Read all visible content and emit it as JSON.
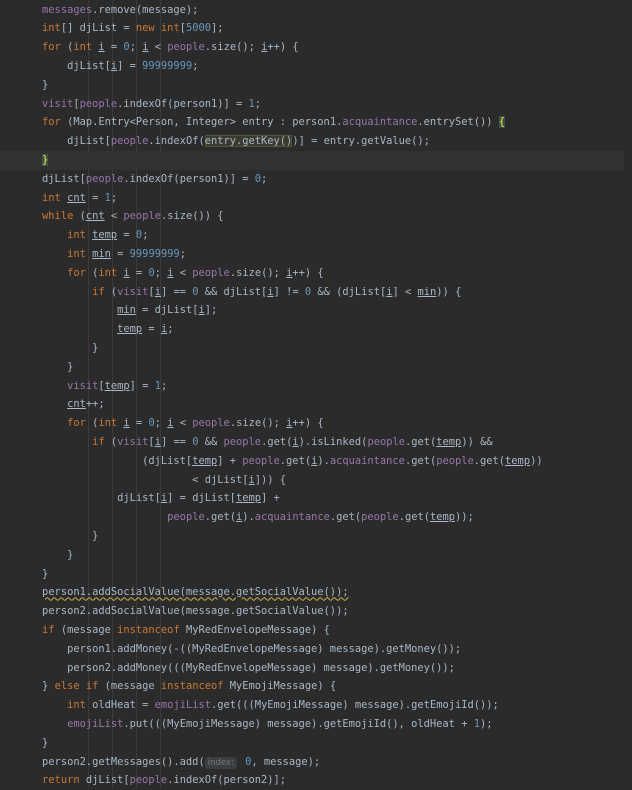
{
  "code_lines": [
    [
      [
        "t",
        "        "
      ],
      [
        "f",
        "messages"
      ],
      [
        "t",
        ".remove(message);"
      ]
    ],
    [
      [
        "t",
        "        "
      ],
      [
        "k",
        "int"
      ],
      [
        "t",
        "[] djList = "
      ],
      [
        "k",
        "new int"
      ],
      [
        "t",
        "["
      ],
      [
        "n",
        "5000"
      ],
      [
        "t",
        "];"
      ]
    ],
    [
      [
        "t",
        "        "
      ],
      [
        "k",
        "for "
      ],
      [
        "t",
        "("
      ],
      [
        "k",
        "int "
      ],
      [
        "u",
        "i"
      ],
      [
        "t",
        " = "
      ],
      [
        "n",
        "0"
      ],
      [
        "t",
        "; "
      ],
      [
        "u",
        "i"
      ],
      [
        "t",
        " < "
      ],
      [
        "f",
        "people"
      ],
      [
        "t",
        ".size(); "
      ],
      [
        "u",
        "i"
      ],
      [
        "t",
        "++) {"
      ]
    ],
    [
      [
        "t",
        "            djList["
      ],
      [
        "u",
        "i"
      ],
      [
        "t",
        "] = "
      ],
      [
        "n",
        "99999999"
      ],
      [
        "t",
        ";"
      ]
    ],
    [
      [
        "t",
        "        }"
      ]
    ],
    [
      [
        "t",
        "        "
      ],
      [
        "f",
        "visit"
      ],
      [
        "t",
        "["
      ],
      [
        "f",
        "people"
      ],
      [
        "t",
        ".indexOf(person1)] = "
      ],
      [
        "n",
        "1"
      ],
      [
        "t",
        ";"
      ]
    ],
    [
      [
        "t",
        "        "
      ],
      [
        "k",
        "for "
      ],
      [
        "t",
        "(Map.Entry<Person, Integer> entry : person1."
      ],
      [
        "f",
        "acquaintance"
      ],
      [
        "t",
        ".entrySet()) "
      ],
      [
        "b",
        "{"
      ]
    ],
    [
      [
        "t",
        "            djList["
      ],
      [
        "f",
        "people"
      ],
      [
        "t",
        ".indexOf("
      ],
      [
        "h",
        "entry.getKey()"
      ],
      [
        "t",
        ")] = entry.getValue();"
      ]
    ],
    [
      [
        "t",
        "        "
      ],
      [
        "b",
        "}"
      ]
    ],
    [
      [
        "t",
        "        djList["
      ],
      [
        "f",
        "people"
      ],
      [
        "t",
        ".indexOf(person1)] = "
      ],
      [
        "n",
        "0"
      ],
      [
        "t",
        ";"
      ]
    ],
    [
      [
        "t",
        "        "
      ],
      [
        "k",
        "int "
      ],
      [
        "u",
        "cnt"
      ],
      [
        "t",
        " = "
      ],
      [
        "n",
        "1"
      ],
      [
        "t",
        ";"
      ]
    ],
    [
      [
        "t",
        "        "
      ],
      [
        "k",
        "while "
      ],
      [
        "t",
        "("
      ],
      [
        "u",
        "cnt"
      ],
      [
        "t",
        " < "
      ],
      [
        "f",
        "people"
      ],
      [
        "t",
        ".size()) {"
      ]
    ],
    [
      [
        "t",
        "            "
      ],
      [
        "k",
        "int "
      ],
      [
        "u",
        "temp"
      ],
      [
        "t",
        " = "
      ],
      [
        "n",
        "0"
      ],
      [
        "t",
        ";"
      ]
    ],
    [
      [
        "t",
        "            "
      ],
      [
        "k",
        "int "
      ],
      [
        "u",
        "min"
      ],
      [
        "t",
        " = "
      ],
      [
        "n",
        "99999999"
      ],
      [
        "t",
        ";"
      ]
    ],
    [
      [
        "t",
        "            "
      ],
      [
        "k",
        "for "
      ],
      [
        "t",
        "("
      ],
      [
        "k",
        "int "
      ],
      [
        "u",
        "i"
      ],
      [
        "t",
        " = "
      ],
      [
        "n",
        "0"
      ],
      [
        "t",
        "; "
      ],
      [
        "u",
        "i"
      ],
      [
        "t",
        " < "
      ],
      [
        "f",
        "people"
      ],
      [
        "t",
        ".size(); "
      ],
      [
        "u",
        "i"
      ],
      [
        "t",
        "++) {"
      ]
    ],
    [
      [
        "t",
        "                "
      ],
      [
        "k",
        "if "
      ],
      [
        "t",
        "("
      ],
      [
        "f",
        "visit"
      ],
      [
        "t",
        "["
      ],
      [
        "u",
        "i"
      ],
      [
        "t",
        "] == "
      ],
      [
        "n",
        "0"
      ],
      [
        "t",
        " && djList["
      ],
      [
        "u",
        "i"
      ],
      [
        "t",
        "] != "
      ],
      [
        "n",
        "0"
      ],
      [
        "t",
        " && (djList["
      ],
      [
        "u",
        "i"
      ],
      [
        "t",
        "] < "
      ],
      [
        "u",
        "min"
      ],
      [
        "t",
        ")) {"
      ]
    ],
    [
      [
        "t",
        "                    "
      ],
      [
        "u",
        "min"
      ],
      [
        "t",
        " = djList["
      ],
      [
        "u",
        "i"
      ],
      [
        "t",
        "];"
      ]
    ],
    [
      [
        "t",
        "                    "
      ],
      [
        "u",
        "temp"
      ],
      [
        "t",
        " = "
      ],
      [
        "u",
        "i"
      ],
      [
        "t",
        ";"
      ]
    ],
    [
      [
        "t",
        "                }"
      ]
    ],
    [
      [
        "t",
        "            }"
      ]
    ],
    [
      [
        "t",
        "            "
      ],
      [
        "f",
        "visit"
      ],
      [
        "t",
        "["
      ],
      [
        "u",
        "temp"
      ],
      [
        "t",
        "] = "
      ],
      [
        "n",
        "1"
      ],
      [
        "t",
        ";"
      ]
    ],
    [
      [
        "t",
        "            "
      ],
      [
        "u",
        "cnt"
      ],
      [
        "t",
        "++;"
      ]
    ],
    [
      [
        "t",
        "            "
      ],
      [
        "k",
        "for "
      ],
      [
        "t",
        "("
      ],
      [
        "k",
        "int "
      ],
      [
        "u",
        "i"
      ],
      [
        "t",
        " = "
      ],
      [
        "n",
        "0"
      ],
      [
        "t",
        "; "
      ],
      [
        "u",
        "i"
      ],
      [
        "t",
        " < "
      ],
      [
        "f",
        "people"
      ],
      [
        "t",
        ".size(); "
      ],
      [
        "u",
        "i"
      ],
      [
        "t",
        "++) {"
      ]
    ],
    [
      [
        "t",
        "                "
      ],
      [
        "k",
        "if "
      ],
      [
        "t",
        "("
      ],
      [
        "f",
        "visit"
      ],
      [
        "t",
        "["
      ],
      [
        "u",
        "i"
      ],
      [
        "t",
        "] == "
      ],
      [
        "n",
        "0"
      ],
      [
        "t",
        " && "
      ],
      [
        "f",
        "people"
      ],
      [
        "t",
        ".get("
      ],
      [
        "u",
        "i"
      ],
      [
        "t",
        ").isLinked("
      ],
      [
        "f",
        "people"
      ],
      [
        "t",
        ".get("
      ],
      [
        "u",
        "temp"
      ],
      [
        "t",
        ")) &&"
      ]
    ],
    [
      [
        "t",
        "                        (djList["
      ],
      [
        "u",
        "temp"
      ],
      [
        "t",
        "] + "
      ],
      [
        "f",
        "people"
      ],
      [
        "t",
        ".get("
      ],
      [
        "u",
        "i"
      ],
      [
        "t",
        ")."
      ],
      [
        "f",
        "acquaintance"
      ],
      [
        "t",
        ".get("
      ],
      [
        "f",
        "people"
      ],
      [
        "t",
        ".get("
      ],
      [
        "u",
        "temp"
      ],
      [
        "t",
        "))"
      ]
    ],
    [
      [
        "t",
        "                                < djList["
      ],
      [
        "u",
        "i"
      ],
      [
        "t",
        "])) {"
      ]
    ],
    [
      [
        "t",
        "                    djList["
      ],
      [
        "u",
        "i"
      ],
      [
        "t",
        "] = djList["
      ],
      [
        "u",
        "temp"
      ],
      [
        "t",
        "] +"
      ]
    ],
    [
      [
        "t",
        "                            "
      ],
      [
        "f",
        "people"
      ],
      [
        "t",
        ".get("
      ],
      [
        "u",
        "i"
      ],
      [
        "t",
        ")."
      ],
      [
        "f",
        "acquaintance"
      ],
      [
        "t",
        ".get("
      ],
      [
        "f",
        "people"
      ],
      [
        "t",
        ".get("
      ],
      [
        "u",
        "temp"
      ],
      [
        "t",
        "));"
      ]
    ],
    [
      [
        "t",
        "                }"
      ]
    ],
    [
      [
        "t",
        "            }"
      ]
    ],
    [
      [
        "t",
        "        }"
      ]
    ],
    [
      [
        "t",
        "        "
      ],
      [
        "w",
        "person1.addSocialValue(message.getSocialValue());"
      ]
    ],
    [
      [
        "t",
        "        person2.addSocialValue(message.getSocialValue());"
      ]
    ],
    [
      [
        "t",
        "        "
      ],
      [
        "k",
        "if "
      ],
      [
        "t",
        "(message "
      ],
      [
        "k",
        "instanceof "
      ],
      [
        "t",
        "MyRedEnvelopeMessage) {"
      ]
    ],
    [
      [
        "t",
        "            person1.addMoney(-((MyRedEnvelopeMessage) message).getMoney());"
      ]
    ],
    [
      [
        "t",
        "            person2.addMoney(((MyRedEnvelopeMessage) message).getMoney());"
      ]
    ],
    [
      [
        "t",
        "        } "
      ],
      [
        "k",
        "else if "
      ],
      [
        "t",
        "(message "
      ],
      [
        "k",
        "instanceof "
      ],
      [
        "t",
        "MyEmojiMessage) {"
      ]
    ],
    [
      [
        "t",
        "            "
      ],
      [
        "k",
        "int "
      ],
      [
        "t",
        "oldHeat = "
      ],
      [
        "f",
        "emojiList"
      ],
      [
        "t",
        ".get(((MyEmojiMessage) message).getEmojiId());"
      ]
    ],
    [
      [
        "t",
        "            "
      ],
      [
        "f",
        "emojiList"
      ],
      [
        "t",
        ".put(((MyEmojiMessage) message).getEmojiId(), oldHeat + "
      ],
      [
        "n",
        "1"
      ],
      [
        "t",
        ");"
      ]
    ],
    [
      [
        "t",
        "        }"
      ]
    ],
    [
      [
        "t",
        "        person2.getMessages().add("
      ],
      [
        "p",
        "index:"
      ],
      [
        "t",
        " "
      ],
      [
        "n",
        "0"
      ],
      [
        "t",
        ", message);"
      ]
    ],
    [
      [
        "t",
        "        "
      ],
      [
        "k",
        "return "
      ],
      [
        "t",
        "djList["
      ],
      [
        "f",
        "people"
      ],
      [
        "t",
        ".indexOf(person2)];"
      ]
    ]
  ],
  "current_line_index": 8,
  "colors": {
    "background": "#2b2b2b",
    "keyword": "#cc7832",
    "number": "#6897bb",
    "field": "#9876aa",
    "text": "#a9b7c6"
  }
}
